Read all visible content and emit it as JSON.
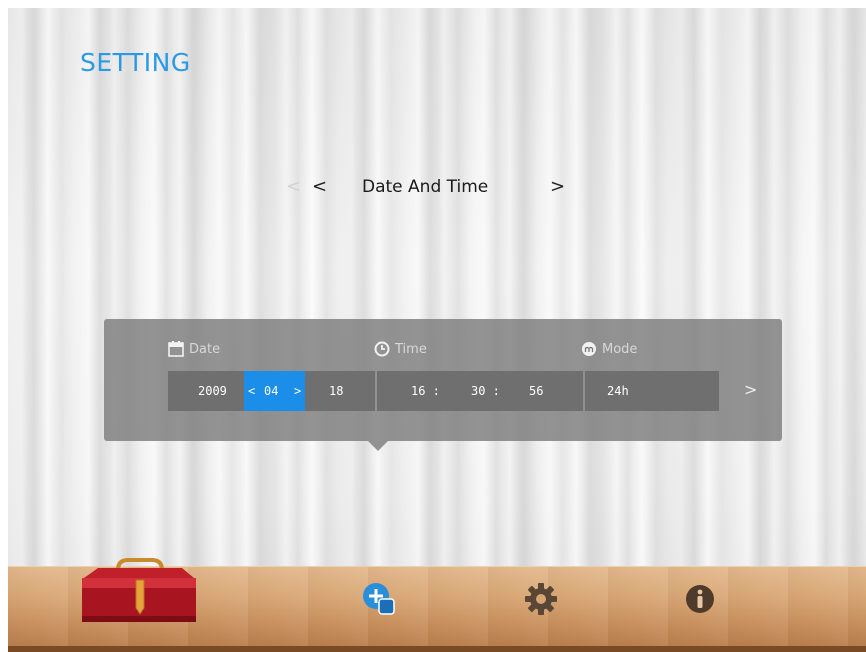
{
  "header": {
    "title": "SETTING"
  },
  "nav": {
    "prev": "<",
    "current": "Date And Time",
    "next": ">",
    "ghost": "<"
  },
  "panel": {
    "date_label": "Date",
    "time_label": "Time",
    "mode_label": "Mode",
    "date": {
      "year": "2009",
      "month_prev": "<",
      "month": "04",
      "month_next": ">",
      "day": "18"
    },
    "time": {
      "hour": "16 :",
      "minute": "30 :",
      "second": "56"
    },
    "mode": {
      "value": "24h"
    },
    "next": ">"
  },
  "dock": {
    "items": [
      "toolbox-icon",
      "add-widget-icon",
      "gear-icon",
      "info-icon"
    ]
  },
  "colors": {
    "accent": "#2a9ae6",
    "selected": "#1a8ee8",
    "panel": "#7d7d7d",
    "shelf": "#d9a877"
  }
}
